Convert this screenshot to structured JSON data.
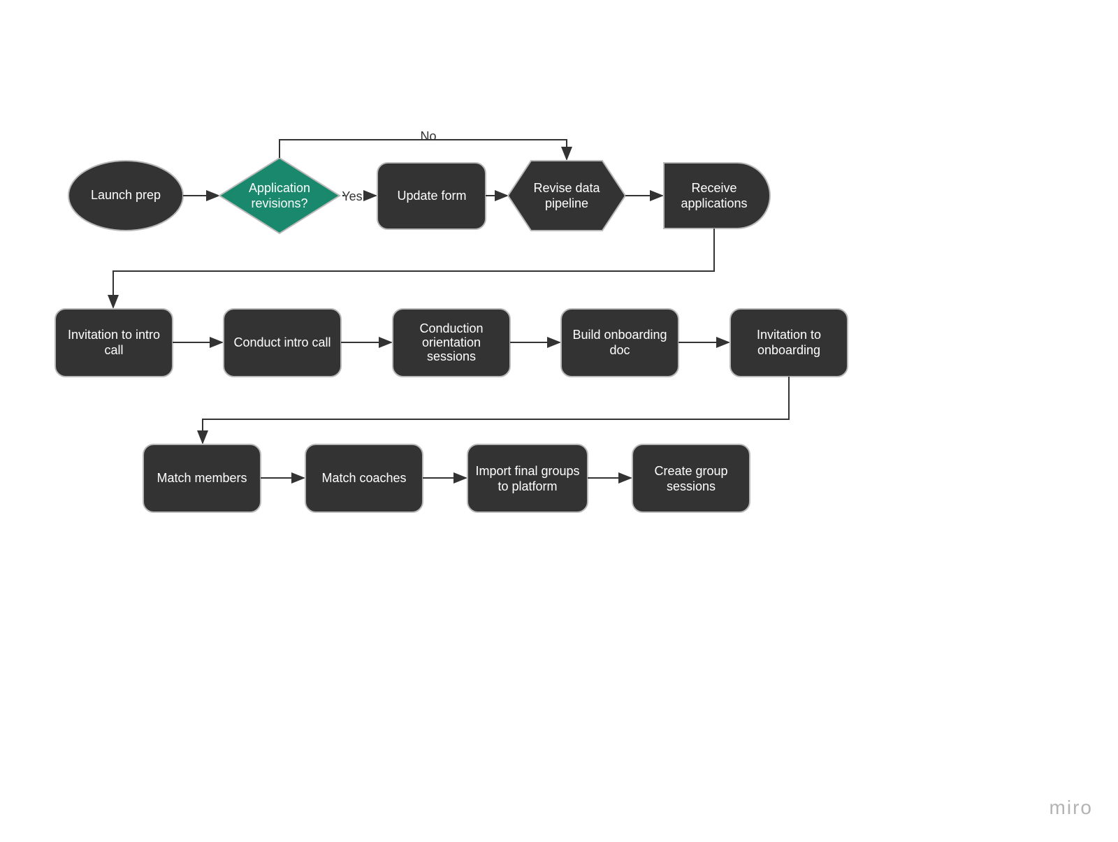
{
  "colors": {
    "node_fill": "#333333",
    "decision_fill": "#19886c",
    "node_stroke": "#b9b9b9",
    "arrow_stroke": "#333333",
    "text_light": "#ffffff",
    "text_dark": "#333333"
  },
  "edge_labels": {
    "no": "No",
    "yes": "Yes"
  },
  "watermark": "miro",
  "nodes": {
    "launch_prep": "Launch prep",
    "app_revisions_l1": "Application",
    "app_revisions_l2": "revisions?",
    "update_form": "Update form",
    "revise_data_l1": "Revise data",
    "revise_data_l2": "pipeline",
    "receive_l1": "Receive",
    "receive_l2": "applications",
    "invite_intro_l1": "Invitation to intro",
    "invite_intro_l2": "call",
    "conduct_intro": "Conduct intro call",
    "orientation_l1": "Conduction",
    "orientation_l2": "orientation",
    "orientation_l3": "sessions",
    "build_doc_l1": "Build onboarding",
    "build_doc_l2": "doc",
    "invite_onboard_l1": "Invitation to",
    "invite_onboard_l2": "onboarding",
    "match_members": "Match members",
    "match_coaches": "Match coaches",
    "import_groups_l1": "Import final groups",
    "import_groups_l2": "to platform",
    "create_sessions_l1": "Create group",
    "create_sessions_l2": "sessions"
  }
}
